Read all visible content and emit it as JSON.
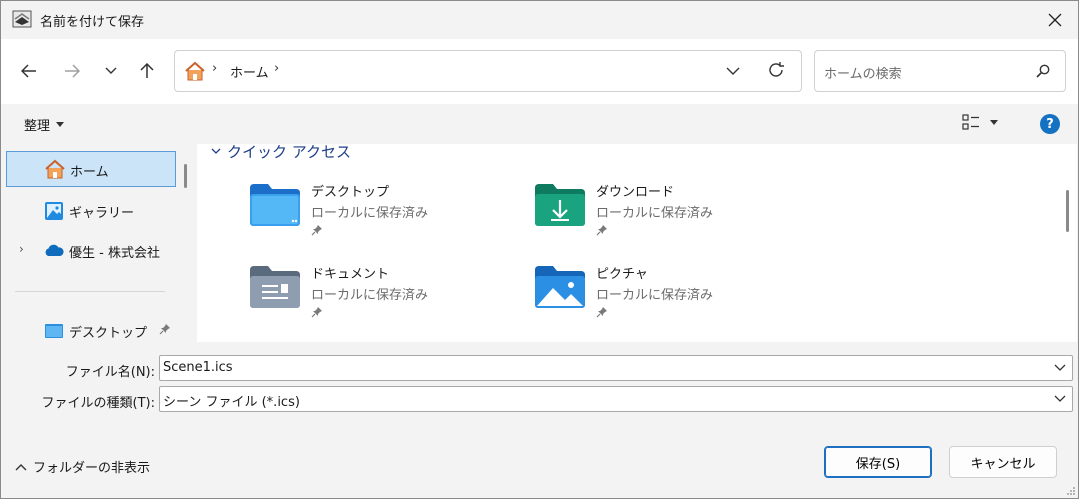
{
  "window": {
    "title": "名前を付けて保存"
  },
  "address": {
    "location": "ホーム"
  },
  "search": {
    "placeholder": "ホームの検索"
  },
  "toolbar": {
    "organize_label": "整理"
  },
  "sidebar": {
    "items": [
      {
        "label": "ホーム"
      },
      {
        "label": "ギャラリー"
      },
      {
        "label": "優生 - 株式会社"
      },
      {
        "label": "デスクトップ"
      }
    ]
  },
  "main": {
    "group_title": "クイック アクセス",
    "tiles": [
      {
        "name": "デスクトップ",
        "sub": "ローカルに保存済み"
      },
      {
        "name": "ダウンロード",
        "sub": "ローカルに保存済み"
      },
      {
        "name": "ドキュメント",
        "sub": "ローカルに保存済み"
      },
      {
        "name": "ピクチャ",
        "sub": "ローカルに保存済み"
      }
    ]
  },
  "fields": {
    "filename_label": "ファイル名(N):",
    "filename_value": "Scene1.ics",
    "filetype_label": "ファイルの種類(T):",
    "filetype_value": "シーン ファイル (*.ics)"
  },
  "footer": {
    "hide_folders_label": "フォルダーの非表示",
    "save_label": "保存(S)",
    "cancel_label": "キャンセル"
  },
  "colors": {
    "accent": "#1e6fc2",
    "selection": "#cce4f7",
    "group_title": "#1f3f8a"
  }
}
